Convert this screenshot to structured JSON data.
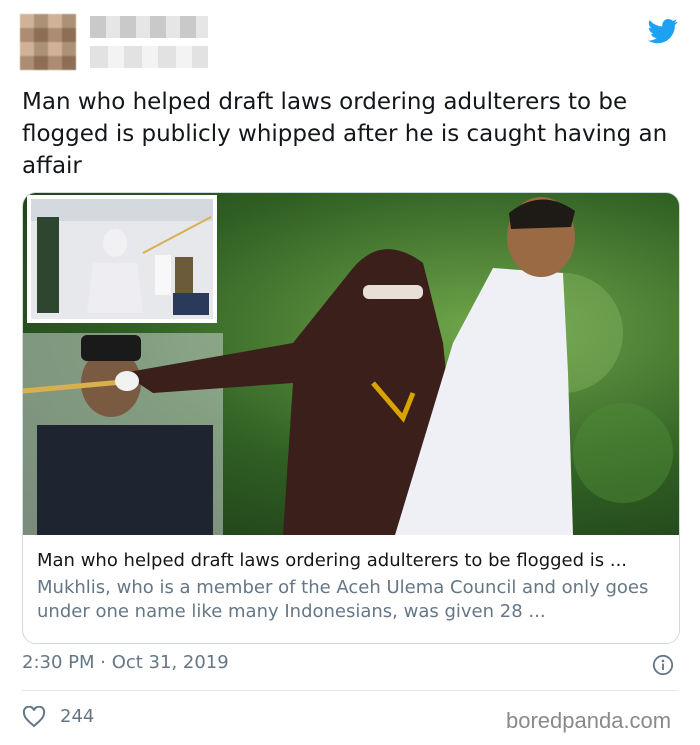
{
  "tweet": {
    "text": "Man who helped draft laws ordering adulterers to be flogged is publicly whipped after he is caught having an affair",
    "timestamp": "2:30 PM · Oct 31, 2019",
    "likes": "244"
  },
  "card": {
    "title": "Man who helped draft laws ordering adulterers to be flogged is ...",
    "description": "Mukhlis, who is a member of the Aceh Ulema Council and only goes under one name like many Indonesians, was given 28 ..."
  },
  "watermark": "boredpanda.com",
  "icons": {
    "brand": "twitter-bird-icon",
    "info": "info-icon",
    "like": "heart-icon"
  },
  "colors": {
    "twitter_blue": "#1da1f2",
    "secondary_text": "#657786",
    "border": "#cfd9de"
  }
}
